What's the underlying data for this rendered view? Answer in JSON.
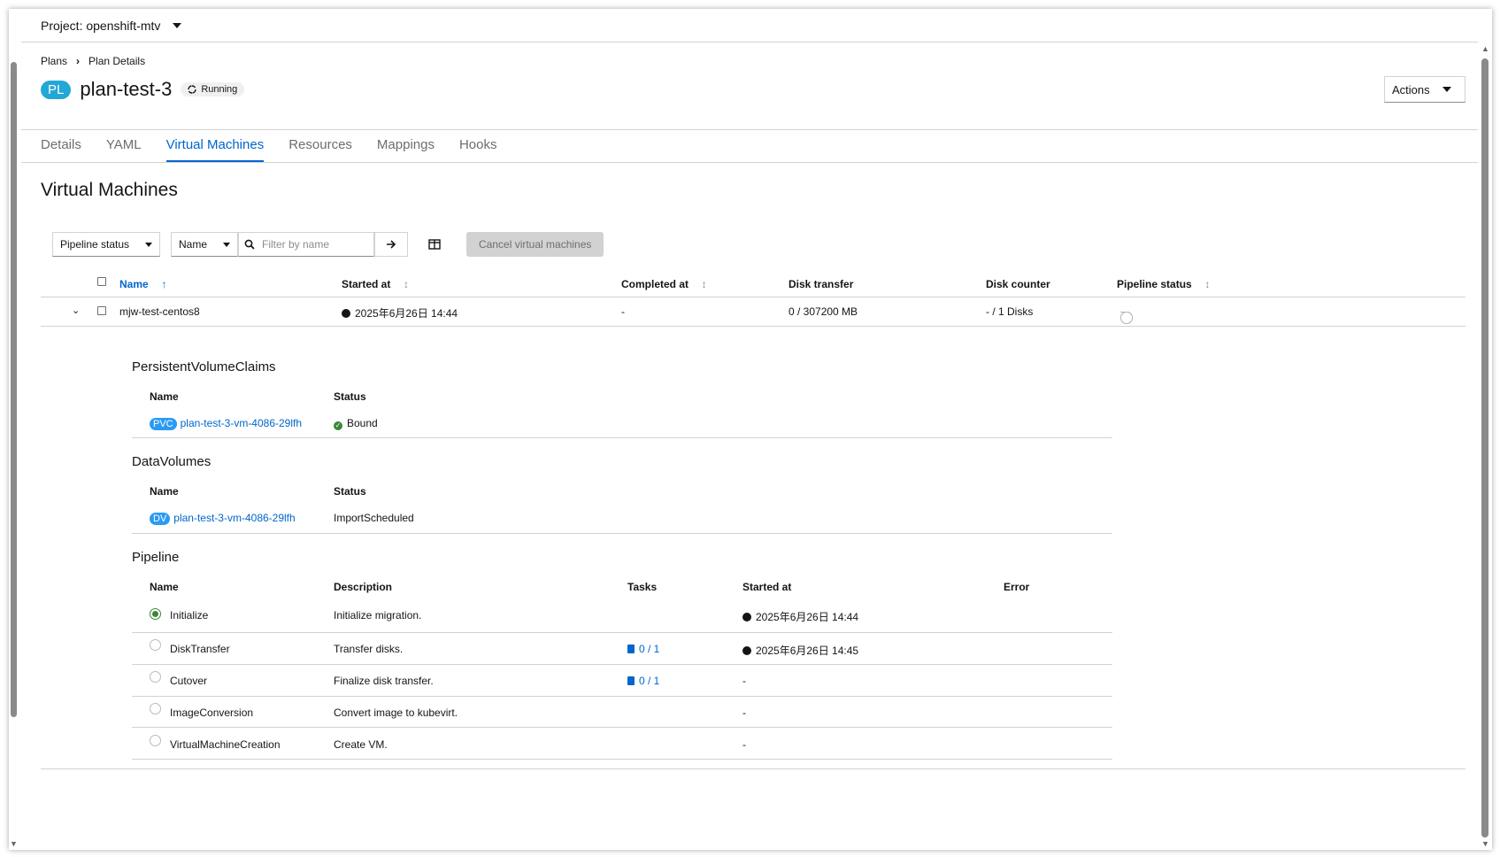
{
  "project": {
    "label": "Project: openshift-mtv"
  },
  "breadcrumb": {
    "plans": "Plans",
    "current": "Plan Details"
  },
  "header": {
    "badge": "PL",
    "title": "plan-test-3",
    "status": "Running",
    "actions_label": "Actions"
  },
  "tabs": [
    {
      "label": "Details"
    },
    {
      "label": "YAML"
    },
    {
      "label": "Virtual Machines"
    },
    {
      "label": "Resources"
    },
    {
      "label": "Mappings"
    },
    {
      "label": "Hooks"
    }
  ],
  "section_title": "Virtual Machines",
  "toolbar": {
    "status_filter": "Pipeline status",
    "name_filter": "Name",
    "search_placeholder": "Filter by name",
    "cancel_label": "Cancel virtual machines"
  },
  "vm_table": {
    "headers": {
      "name": "Name",
      "started": "Started at",
      "completed": "Completed at",
      "disk_transfer": "Disk transfer",
      "disk_counter": "Disk counter",
      "pipeline": "Pipeline status"
    },
    "row": {
      "name": "mjw-test-centos8",
      "started": "2025年6月26日 14:44",
      "completed": "-",
      "disk_transfer": "0 / 307200 MB",
      "disk_counter": "- / 1 Disks",
      "pipeline_steps": 5,
      "pipeline_active_index": 0
    }
  },
  "pvc": {
    "title": "PersistentVolumeClaims",
    "headers": {
      "name": "Name",
      "status": "Status"
    },
    "badge": "PVC",
    "name": "plan-test-3-vm-4086-29lfh",
    "status": "Bound"
  },
  "dv": {
    "title": "DataVolumes",
    "headers": {
      "name": "Name",
      "status": "Status"
    },
    "badge": "DV",
    "name": "plan-test-3-vm-4086-29lfh",
    "status": "ImportScheduled"
  },
  "pipeline": {
    "title": "Pipeline",
    "headers": {
      "name": "Name",
      "description": "Description",
      "tasks": "Tasks",
      "started": "Started at",
      "error": "Error"
    },
    "rows": [
      {
        "name": "Initialize",
        "description": "Initialize migration.",
        "tasks": "",
        "started": "2025年6月26日 14:44"
      },
      {
        "name": "DiskTransfer",
        "description": "Transfer disks.",
        "tasks": "0 / 1",
        "started": "2025年6月26日 14:45"
      },
      {
        "name": "Cutover",
        "description": "Finalize disk transfer.",
        "tasks": "0 / 1",
        "started": "-"
      },
      {
        "name": "ImageConversion",
        "description": "Convert image to kubevirt.",
        "tasks": "",
        "started": "-"
      },
      {
        "name": "VirtualMachineCreation",
        "description": "Create VM.",
        "tasks": "",
        "started": "-"
      }
    ]
  }
}
